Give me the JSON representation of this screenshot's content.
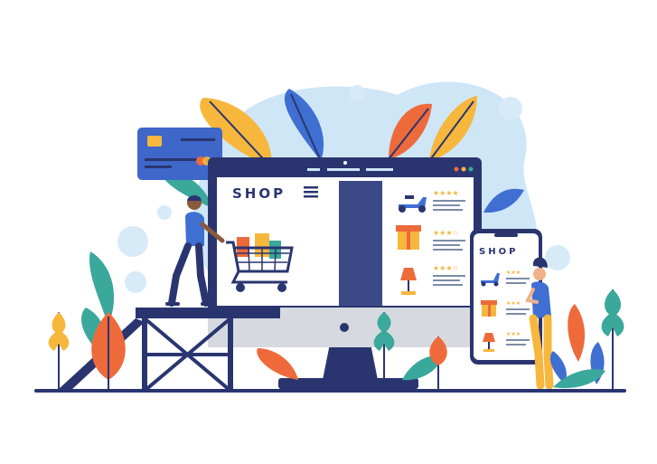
{
  "monitor": {
    "shop_label": "SHOP"
  },
  "phone": {
    "shop_label": "SHOP"
  },
  "colors": {
    "navy": "#2a3570",
    "blob": "#cfe6f7",
    "orange": "#ee6a3b",
    "yellow": "#f6b73c",
    "teal": "#3aa89a",
    "blue": "#3f6fd0",
    "card": "#3f66c9",
    "grey": "#d6d9df",
    "star": "#f4b63a"
  },
  "products": [
    {
      "icon": "scooter-icon",
      "rating_stars": 4
    },
    {
      "icon": "gift-box-icon",
      "rating_stars": 3
    },
    {
      "icon": "lamp-icon",
      "rating_stars": 3
    }
  ],
  "phone_products": [
    {
      "icon": "scooter-icon",
      "rating_stars": 3
    },
    {
      "icon": "gift-box-icon",
      "rating_stars": 3
    },
    {
      "icon": "lamp-icon",
      "rating_stars": 3
    }
  ]
}
